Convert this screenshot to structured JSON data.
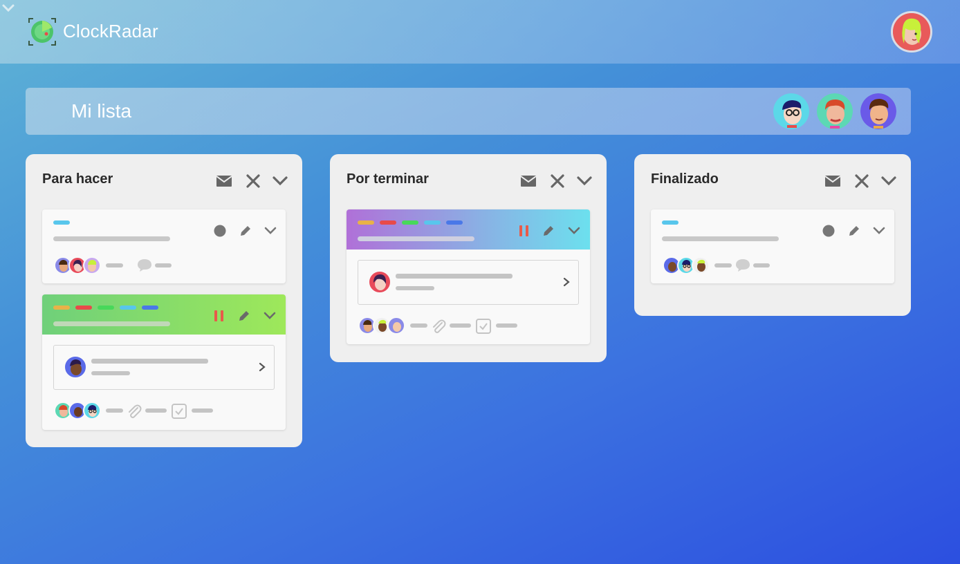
{
  "app": {
    "name": "ClockRadar"
  },
  "list": {
    "title": "Mi lista"
  },
  "columns": [
    {
      "title": "Para hacer"
    },
    {
      "title": "Por terminar"
    },
    {
      "title": "Finalizado"
    }
  ],
  "icons": {
    "logo": "radar-clock-icon",
    "mail": "mail-icon",
    "close": "close-icon",
    "collapse": "chevron-down-icon",
    "status": "circle-icon",
    "edit": "pencil-icon",
    "pause": "pause-icon",
    "open": "chevron-right-icon",
    "comment": "comment-icon",
    "attach": "paperclip-icon",
    "check": "checkbox-icon"
  },
  "colors": {
    "label_cyan": "#58c6ec",
    "label_orange": "#e8b248",
    "label_red": "#e84a4a",
    "label_green": "#48d85a",
    "label_blue": "#4a78e8",
    "pause_red": "#e85a4a",
    "head_green": "#6fd07a",
    "head_purple": "#b070d8",
    "head_cyan": "#6ce0ee"
  }
}
